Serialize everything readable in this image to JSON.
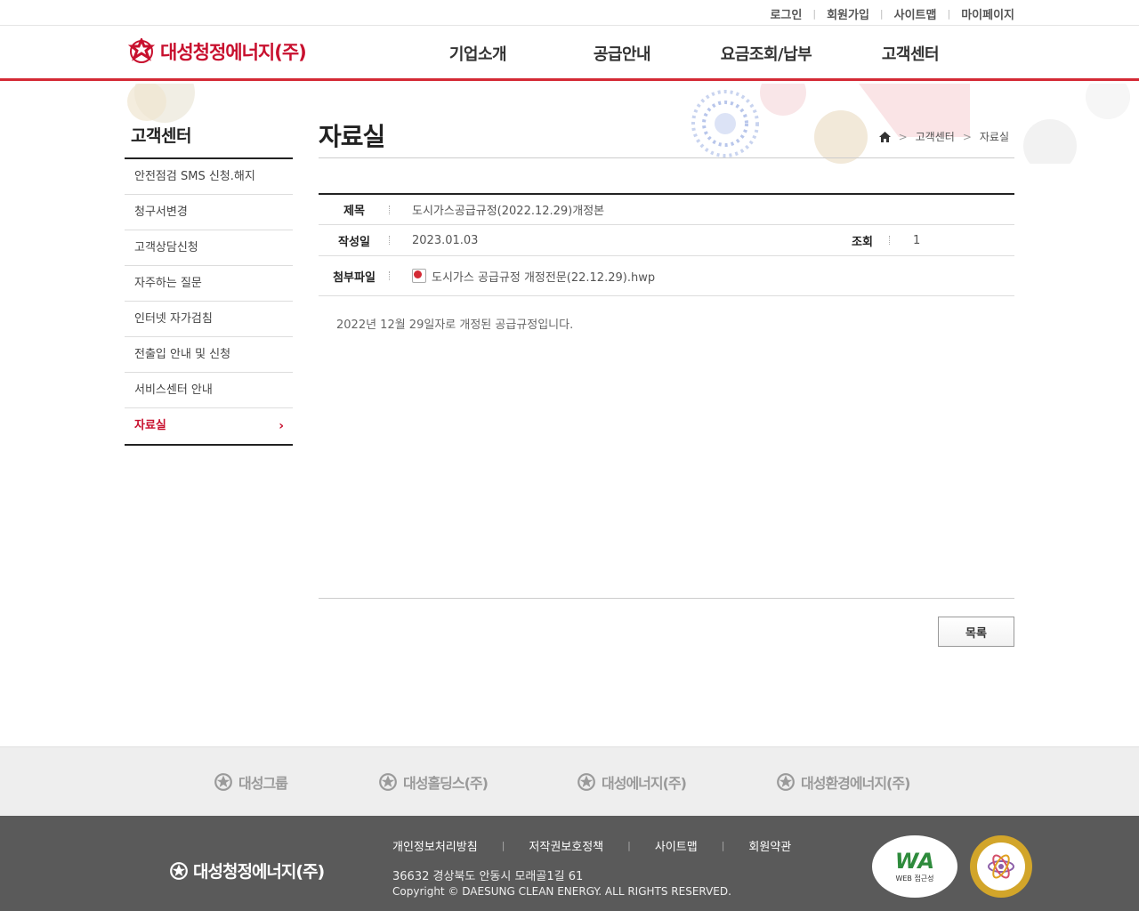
{
  "util_nav": [
    "로그인",
    "회원가입",
    "사이트맵",
    "마이페이지"
  ],
  "brand": {
    "name": "대성청정에너지(주)",
    "color": "#c8102e"
  },
  "gnb": [
    "기업소개",
    "공급안내",
    "요금조회/납부",
    "고객센터"
  ],
  "sidebar": {
    "title": "고객센터",
    "items": [
      {
        "label": "안전점검 SMS 신청.해지"
      },
      {
        "label": "청구서변경"
      },
      {
        "label": "고객상담신청"
      },
      {
        "label": "자주하는 질문"
      },
      {
        "label": "인터넷 자가검침"
      },
      {
        "label": "전출입 안내 및 신청"
      },
      {
        "label": "서비스센터 안내"
      },
      {
        "label": "자료실",
        "active": true
      }
    ]
  },
  "page": {
    "title": "자료실",
    "breadcrumb": [
      "고객센터",
      "자료실"
    ]
  },
  "post": {
    "subject_label": "제목",
    "subject": "도시가스공급규정(2022.12.29)개정본",
    "date_label": "작성일",
    "date": "2023.01.03",
    "views_label": "조회",
    "views": "1",
    "attach_label": "첨부파일",
    "attachment": "도시가스 공급규정 개정전문(22.12.29).hwp",
    "body": "2022년 12월 29일자로 개정된 공급규정입니다."
  },
  "list_button": "목록",
  "family_sites": [
    "대성그룹",
    "대성홀딩스(주)",
    "대성에너지(주)",
    "대성환경에너지(주)"
  ],
  "footer": {
    "logo_text": "대성청정에너지(주)",
    "links": [
      "개인정보처리방침",
      "저작권보호정책",
      "사이트맵",
      "회원약관"
    ],
    "address": "36632 경상북도 안동시 모래골1길 61",
    "copyright": "Copyright © DAESUNG CLEAN ENERGY. ALL RIGHTS RESERVED.",
    "badge_wa": "WA",
    "badge_wa_sub": "WEB 접근성"
  }
}
